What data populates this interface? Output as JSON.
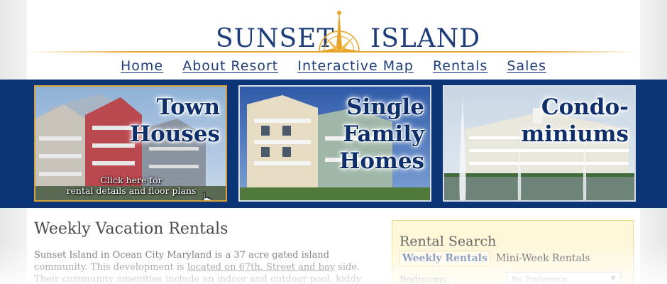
{
  "header": {
    "logo_left": "SUNSET",
    "logo_right": "ISLAND",
    "logo_icon": "compass-rose-icon"
  },
  "nav": {
    "items": [
      "Home",
      "About Resort",
      "Interactive Map",
      "Rentals",
      "Sales"
    ]
  },
  "cards": [
    {
      "title_lines": [
        "Town",
        "Houses"
      ],
      "caption_line1": "Click here for",
      "caption_line2": "rental details and floor plans"
    },
    {
      "title_lines": [
        "Single",
        "Family",
        "Homes"
      ]
    },
    {
      "title_lines": [
        "Condo-",
        "miniums"
      ]
    }
  ],
  "main": {
    "heading": "Weekly Vacation Rentals",
    "paragraph_part1": "Sunset Island in Ocean City Maryland is a 37 acre gated island community. This development is ",
    "paragraph_link": "located on 67th. Street and bay",
    "paragraph_part2": " side. Their community amenities include an indoor and outdoor pool, kiddy pool, exercise room,"
  },
  "search": {
    "title": "Rental Search",
    "tabs": [
      "Weekly Rentals",
      "Mini-Week Rentals"
    ],
    "bedrooms_label": "Bedrooms:",
    "bedrooms_value": "No Preference"
  },
  "colors": {
    "brand_navy": "#1d3d7a",
    "band_blue": "#0b3576",
    "accent_gold": "#e8a428"
  }
}
